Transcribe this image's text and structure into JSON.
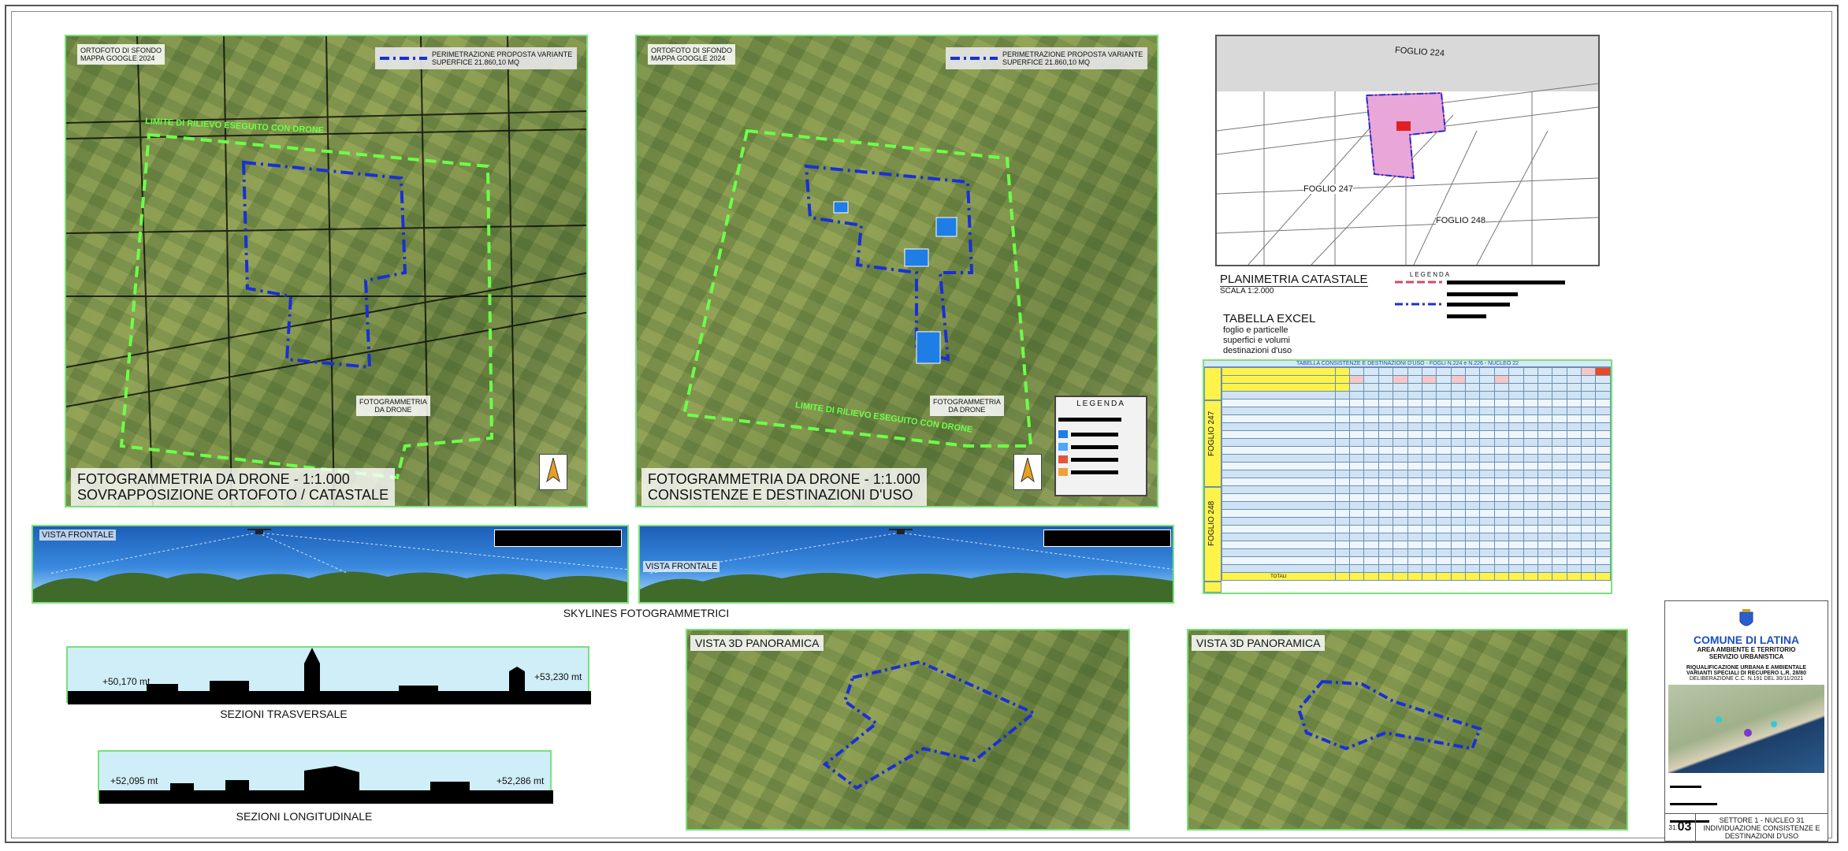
{
  "photo_left": {
    "source_line1": "ORTOFOTO DI SFONDO",
    "source_line2": "MAPPA GOOGLE 2024",
    "legend_line1": "PERIMETRAZIONE PROPOSTA VARIANTE",
    "legend_line2": "SUPERFICE 21.860,10 MQ",
    "boundary_label": "LIMITE DI RILIEVO ESEGUITO CON DRONE",
    "drone_label_line1": "FOTOGRAMMETRIA",
    "drone_label_line2": "DA DRONE",
    "title_line1": "FOTOGRAMMETRIA DA DRONE - 1:1.000",
    "title_line2": "SOVRAPPOSIZIONE ORTOFOTO / CATASTALE"
  },
  "photo_right": {
    "source_line1": "ORTOFOTO DI SFONDO",
    "source_line2": "MAPPA GOOGLE 2024",
    "legend_line1": "PERIMETRAZIONE PROPOSTA VARIANTE",
    "legend_line2": "SUPERFICE 21.860,10 MQ",
    "boundary_label": "LIMITE DI RILIEVO ESEGUITO CON DRONE",
    "drone_label_line1": "FOTOGRAMMETRIA",
    "drone_label_line2": "DA DRONE",
    "legend_title": "LEGENDA",
    "title_line1": "FOTOGRAMMETRIA DA DRONE - 1:1.000",
    "title_line2": "CONSISTENZE E DESTINAZIONI D'USO"
  },
  "cadastral": {
    "foglio_224": "FOGLIO 224",
    "foglio_247": "FOGLIO 247",
    "foglio_248": "FOGLIO 248",
    "title": "PLANIMETRIA CATASTALE",
    "scale": "SCALA 1:2.000",
    "legend_title": "LEGENDA"
  },
  "excel": {
    "title": "TABELLA EXCEL",
    "line1": "foglio e particelle",
    "line2": "superfici e volumi",
    "line3": "destinazioni d'uso",
    "table_title": "TABELLA CONSISTENZE E DESTINAZIONI D'USO - FOGLI N.224 e N.226 - NUCLEO 22",
    "foglio_247": "FOGLIO 247",
    "foglio_248": "FOGLIO 248",
    "total_label": "TOTALI"
  },
  "skylines": {
    "left_label": "VISTA FRONTALE",
    "right_label": "VISTA FRONTALE",
    "caption": "SKYLINES FOTOGRAMMETRICI"
  },
  "sections": {
    "trasv_left": "+50,170 mt",
    "trasv_right": "+53,230 mt",
    "trasv_caption": "SEZIONI TRASVERSALE",
    "long_left": "+52,095 mt",
    "long_right": "+52,286 mt",
    "long_caption": "SEZIONI LONGITUDINALE"
  },
  "views3d": {
    "left_label": "VISTA 3D PANORAMICA",
    "right_label": "VISTA 3D PANORAMICA"
  },
  "title_block": {
    "comune": "COMUNE DI LATINA",
    "area": "AREA AMBIENTE E TERRITORIO",
    "servizio": "SERVIZIO URBANISTICA",
    "project_line1": "RIQUALIFICAZIONE URBANA E AMBIENTALE",
    "project_line2": "VARIANTI SPECIALI DI RECUPERO L.R. 28/80",
    "delibera": "DELIBERAZIONE C.C. N.191 DEL 30/11/2021",
    "sheet_prefix": "31.",
    "sheet_number": "03",
    "sector": "SETTORE 1 - NUCLEO 31",
    "desc_line1": "INDIVIDUAZIONE CONSISTENZE E",
    "desc_line2": "DESTINAZIONI D'USO"
  },
  "colors": {
    "frame_green": "#7be07b",
    "perimeter_blue": "#1a2fd6",
    "boundary_green": "#6dff4a",
    "comune_blue": "#1b4fc4"
  }
}
